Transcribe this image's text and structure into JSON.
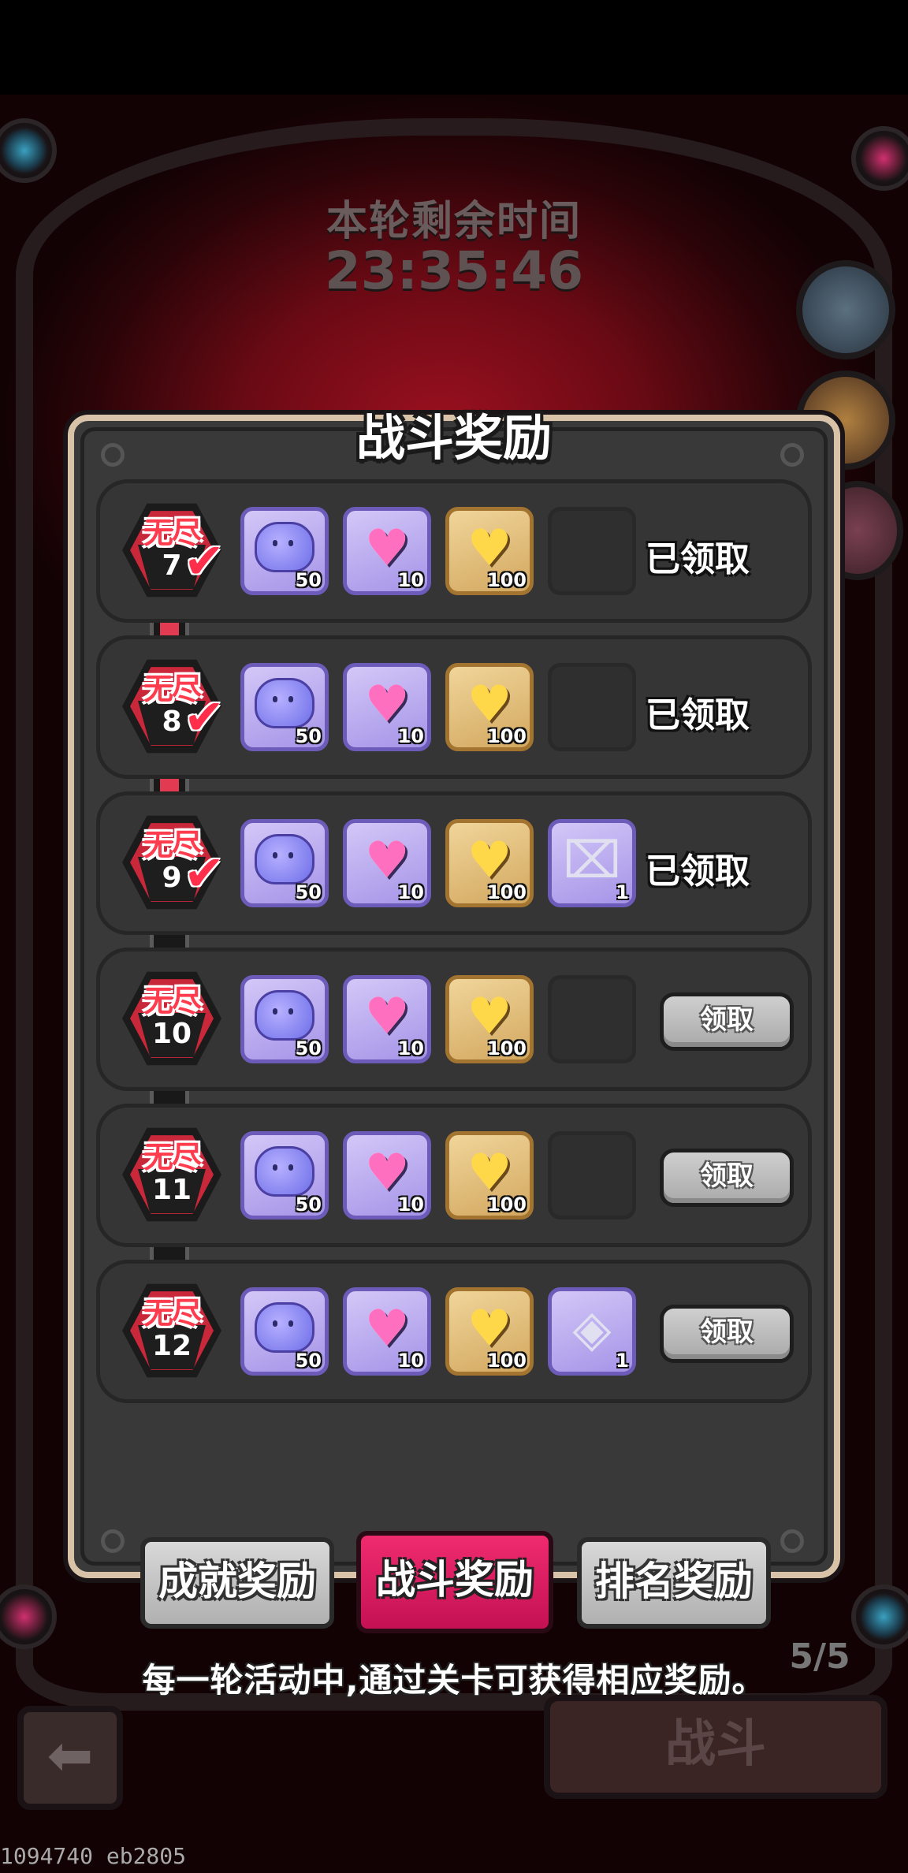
{
  "timer": {
    "label": "本轮剩余时间",
    "value": "23:35:46"
  },
  "panel": {
    "title": "战斗奖励"
  },
  "rows": [
    {
      "badge_label": "无尽",
      "level": "7",
      "completed": true,
      "items": [
        {
          "icon": "slime",
          "count": "50"
        },
        {
          "icon": "crystal-heart",
          "count": "10"
        },
        {
          "icon": "gold-heart",
          "count": "100"
        },
        {
          "icon": "empty",
          "count": ""
        }
      ],
      "status": "已领取",
      "claim_label": ""
    },
    {
      "badge_label": "无尽",
      "level": "8",
      "completed": true,
      "items": [
        {
          "icon": "slime",
          "count": "50"
        },
        {
          "icon": "crystal-heart",
          "count": "10"
        },
        {
          "icon": "gold-heart",
          "count": "100"
        },
        {
          "icon": "empty",
          "count": ""
        }
      ],
      "status": "已领取",
      "claim_label": ""
    },
    {
      "badge_label": "无尽",
      "level": "9",
      "completed": true,
      "items": [
        {
          "icon": "slime",
          "count": "50"
        },
        {
          "icon": "crystal-heart",
          "count": "10"
        },
        {
          "icon": "gold-heart",
          "count": "100"
        },
        {
          "icon": "ink-bottle",
          "count": "1"
        }
      ],
      "status": "已领取",
      "claim_label": ""
    },
    {
      "badge_label": "无尽",
      "level": "10",
      "completed": false,
      "items": [
        {
          "icon": "slime",
          "count": "50"
        },
        {
          "icon": "crystal-heart",
          "count": "10"
        },
        {
          "icon": "gold-heart",
          "count": "100"
        },
        {
          "icon": "empty",
          "count": ""
        }
      ],
      "status": "",
      "claim_label": "领取"
    },
    {
      "badge_label": "无尽",
      "level": "11",
      "completed": false,
      "items": [
        {
          "icon": "slime",
          "count": "50"
        },
        {
          "icon": "crystal-heart",
          "count": "10"
        },
        {
          "icon": "gold-heart",
          "count": "100"
        },
        {
          "icon": "empty",
          "count": ""
        }
      ],
      "status": "",
      "claim_label": "领取"
    },
    {
      "badge_label": "无尽",
      "level": "12",
      "completed": false,
      "items": [
        {
          "icon": "slime",
          "count": "50"
        },
        {
          "icon": "crystal-heart",
          "count": "10"
        },
        {
          "icon": "gold-heart",
          "count": "100"
        },
        {
          "icon": "dice-piece",
          "count": "1"
        }
      ],
      "status": "",
      "claim_label": "领取"
    }
  ],
  "tabs": [
    {
      "label": "成就奖励",
      "active": false
    },
    {
      "label": "战斗奖励",
      "active": true
    },
    {
      "label": "排名奖励",
      "active": false
    }
  ],
  "description": "每一轮活动中,通过关卡可获得相应奖励。",
  "page_count": "5/5",
  "battle_button": "战斗",
  "footer_id": "1094740 eb2805",
  "colors": {
    "accent_red": "#e23a50",
    "active_tab": "#e0206a",
    "panel_bg": "#3a3a3a"
  }
}
